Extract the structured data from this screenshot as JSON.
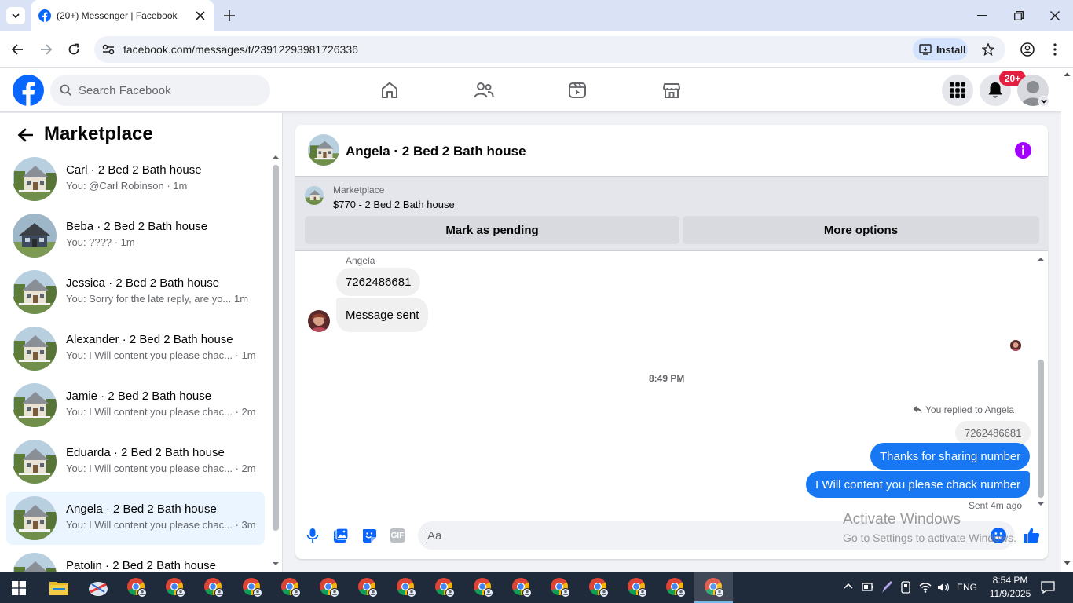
{
  "browser": {
    "tab_title": "(20+) Messenger | Facebook",
    "url": "facebook.com/messages/t/23912293981726336",
    "install_label": "Install"
  },
  "fb": {
    "search_placeholder": "Search Facebook",
    "notif_badge": "20+",
    "brand_color": "#0866ff"
  },
  "sidebar": {
    "title": "Marketplace",
    "conversations": [
      {
        "name": "Carl · 2 Bed 2 Bath house",
        "preview": "You: @Carl Robinson · 1m"
      },
      {
        "name": "Beba · 2 Bed 2 Bath house",
        "preview": "You: ???? · 1m"
      },
      {
        "name": "Jessica · 2 Bed 2 Bath house",
        "preview": "You: Sorry for the late reply, are yo...",
        "time": "1m"
      },
      {
        "name": "Alexander · 2 Bed 2 Bath house",
        "preview": "You: I Will content you please chac... · 1m"
      },
      {
        "name": "Jamie · 2 Bed 2 Bath house",
        "preview": "You: I Will content you please chac... · 2m"
      },
      {
        "name": "Eduarda · 2 Bed 2 Bath house",
        "preview": "You: I Will content you please chac... · 2m"
      },
      {
        "name": "Angela · 2 Bed 2 Bath house",
        "preview": "You: I Will content you please chac... · 3m"
      },
      {
        "name": "Patolin · 2 Bed 2 Bath house",
        "preview": ""
      }
    ]
  },
  "chat": {
    "header_title": "Angela · 2 Bed 2 Bath house",
    "listing_label": "Marketplace",
    "listing_title": "$770 - 2 Bed 2 Bath house",
    "mark_pending": "Mark as pending",
    "more_options": "More options",
    "sender_name": "Angela",
    "msg_in_1": "7262486681",
    "msg_in_2": "Message sent",
    "timestamp": "8:49 PM",
    "replied_label": "You replied to Angela",
    "quoted": "7262486681",
    "msg_out_1": "Thanks for sharing number",
    "msg_out_2": "I Will content you please chack number",
    "sent_status": "Sent 4m ago",
    "composer_placeholder": "Aa"
  },
  "watermark": {
    "line1": "Activate Windows",
    "line2": "Go to Settings to activate Windows."
  },
  "taskbar": {
    "lang": "ENG",
    "time": "8:54 PM",
    "date": "11/9/2025"
  }
}
